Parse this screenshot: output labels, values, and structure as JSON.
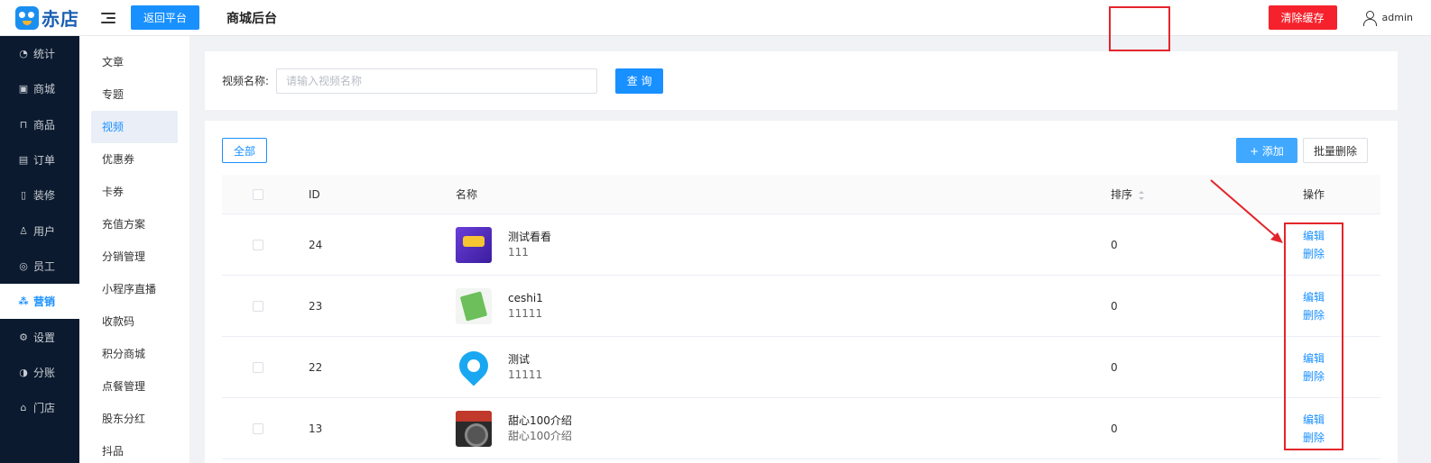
{
  "header": {
    "logo_text": "赤店",
    "return_label": "返回平台",
    "title": "商城后台",
    "clear_cache_label": "清除缓存",
    "username": "admin"
  },
  "primary_nav": [
    {
      "label": "统计",
      "icon": "chart-icon",
      "glyph": "◔"
    },
    {
      "label": "商城",
      "icon": "store-icon",
      "glyph": "▣"
    },
    {
      "label": "商品",
      "icon": "goods-icon",
      "glyph": "⊓"
    },
    {
      "label": "订单",
      "icon": "order-icon",
      "glyph": "▤"
    },
    {
      "label": "装修",
      "icon": "phone-icon",
      "glyph": "▯"
    },
    {
      "label": "用户",
      "icon": "user-icon",
      "glyph": "♙"
    },
    {
      "label": "员工",
      "icon": "staff-icon",
      "glyph": "◎"
    },
    {
      "label": "营销",
      "icon": "marketing-icon",
      "glyph": "⁂",
      "active": true
    },
    {
      "label": "设置",
      "icon": "gear-icon",
      "glyph": "⚙"
    },
    {
      "label": "分账",
      "icon": "split-icon",
      "glyph": "◑"
    },
    {
      "label": "门店",
      "icon": "shop-icon",
      "glyph": "⌂"
    }
  ],
  "secondary_nav": [
    {
      "label": "文章"
    },
    {
      "label": "专题"
    },
    {
      "label": "视频",
      "active": true
    },
    {
      "label": "优惠券"
    },
    {
      "label": "卡券"
    },
    {
      "label": "充值方案"
    },
    {
      "label": "分销管理"
    },
    {
      "label": "小程序直播"
    },
    {
      "label": "收款码"
    },
    {
      "label": "积分商城"
    },
    {
      "label": "点餐管理"
    },
    {
      "label": "股东分红"
    },
    {
      "label": "抖品"
    }
  ],
  "search": {
    "label": "视频名称:",
    "placeholder": "请输入视频名称",
    "value": "",
    "query_label": "查 询"
  },
  "toolbar": {
    "all_label": "全部",
    "add_label": "+ 添加",
    "batch_delete_label": "批量删除"
  },
  "table": {
    "columns": {
      "id": "ID",
      "name": "名称",
      "sort": "排序",
      "ops": "操作"
    },
    "rows": [
      {
        "id": "24",
        "title": "测试看看",
        "desc": "111",
        "sort": "0",
        "thumb": "thumb-1",
        "edit": "编辑",
        "delete": "删除"
      },
      {
        "id": "23",
        "title": "ceshi1",
        "desc": "11111",
        "sort": "0",
        "thumb": "thumb-2",
        "edit": "编辑",
        "delete": "删除"
      },
      {
        "id": "22",
        "title": "测试",
        "desc": "11111",
        "sort": "0",
        "thumb": "thumb-3",
        "edit": "编辑",
        "delete": "删除"
      },
      {
        "id": "13",
        "title": "甜心100介绍",
        "desc": "甜心100介绍",
        "sort": "0",
        "thumb": "thumb-4",
        "edit": "编辑",
        "delete": "删除"
      }
    ]
  },
  "colors": {
    "primary": "#1890ff",
    "danger": "#f5222d",
    "sidebar": "#0b1a2e",
    "annotation": "#e3252b"
  }
}
